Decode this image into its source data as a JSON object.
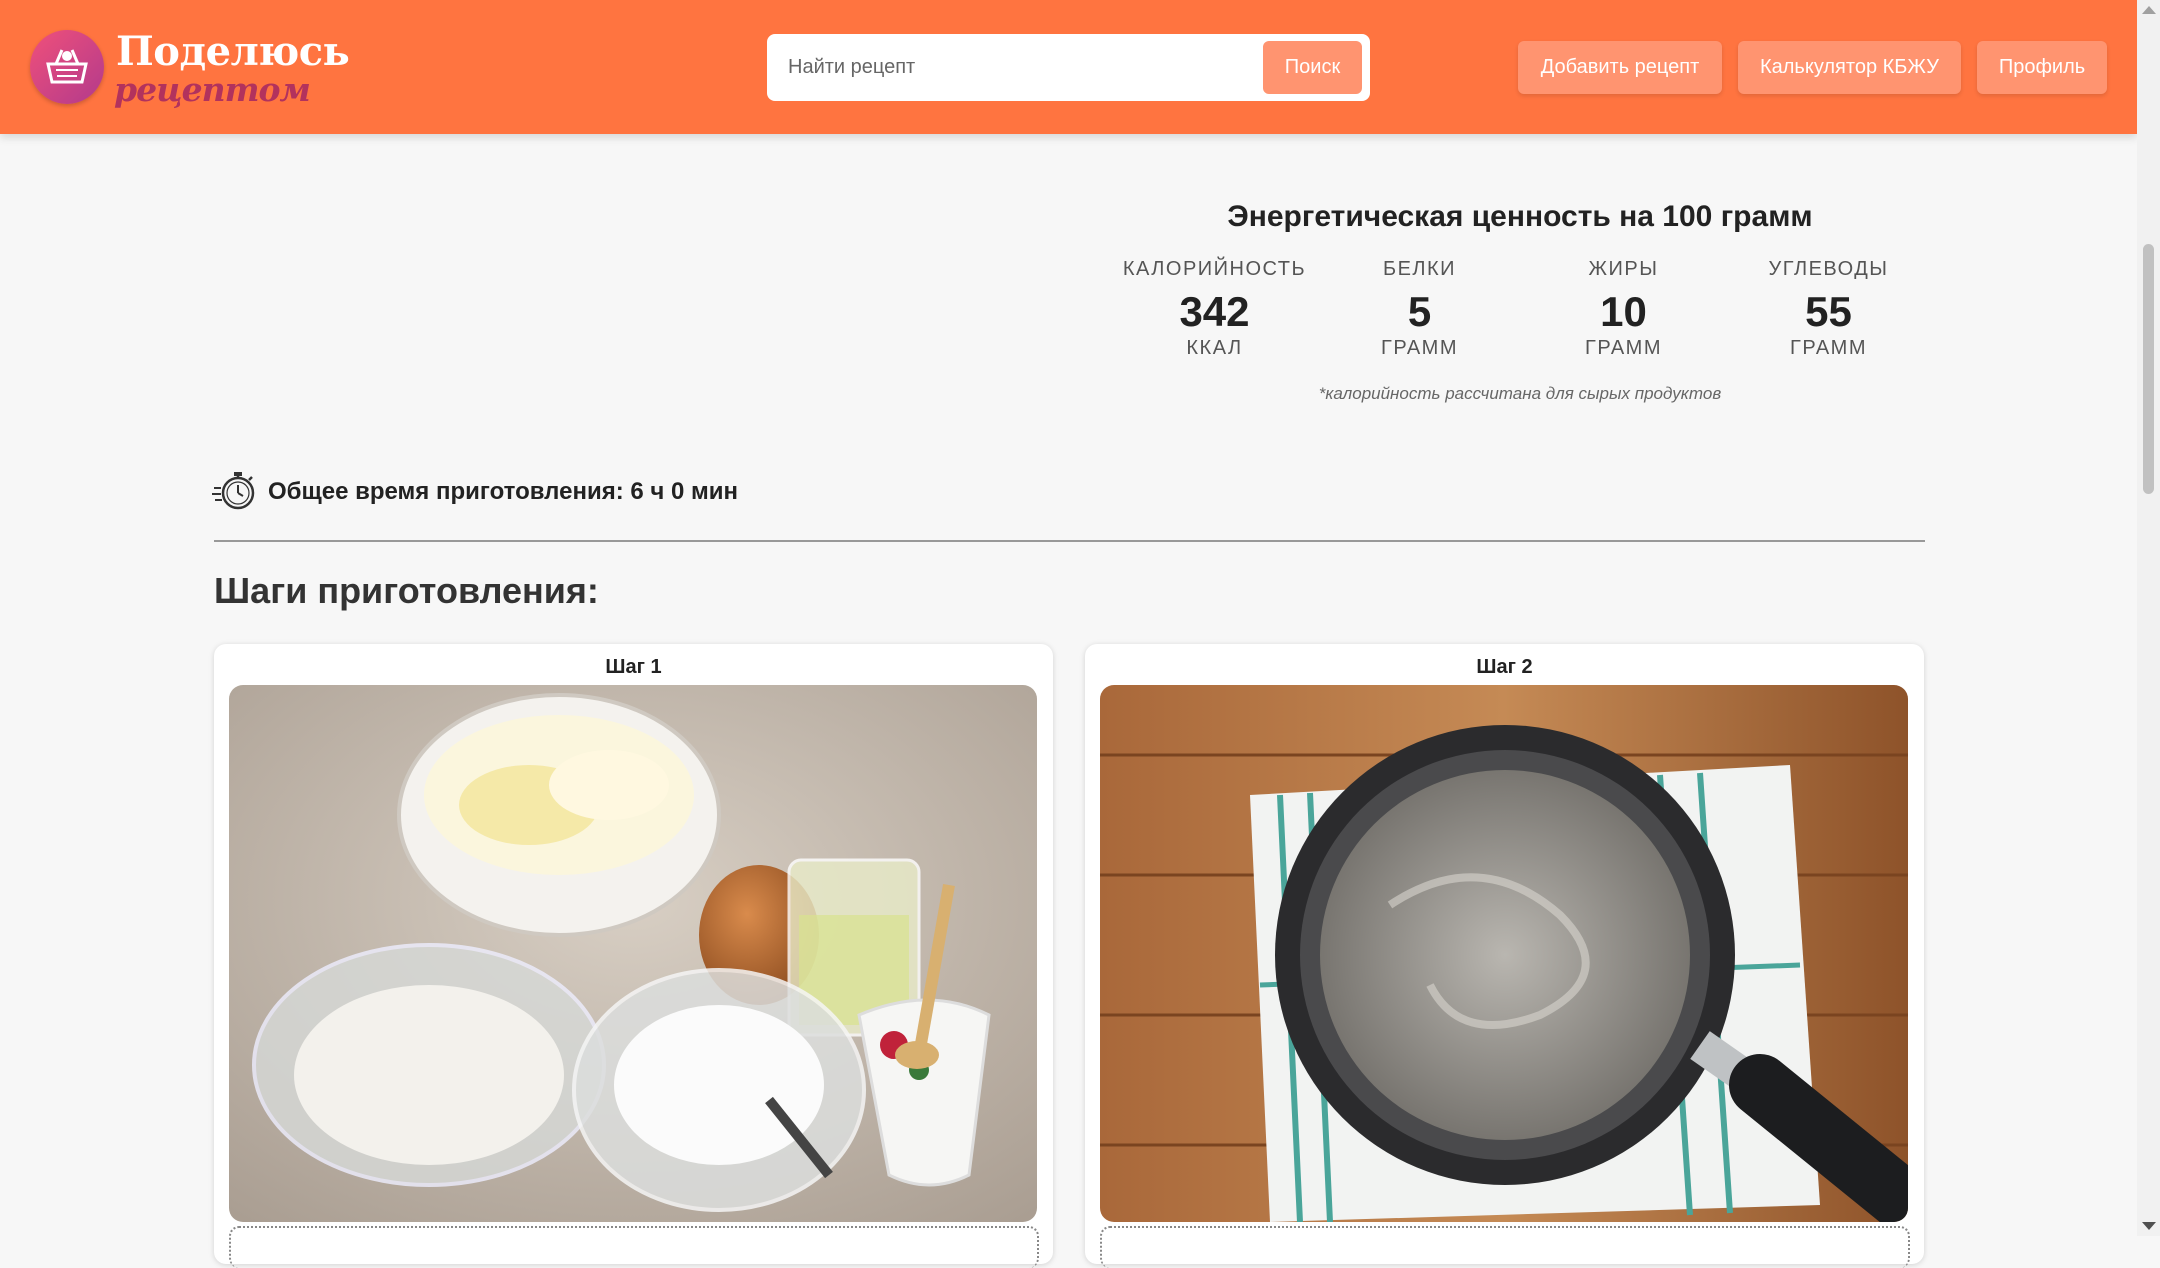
{
  "header": {
    "logo_line1": "Поделюсь",
    "logo_line2": "рецептом",
    "search": {
      "placeholder": "Найти рецепт",
      "button_label": "Поиск"
    },
    "nav": [
      "Добавить рецепт",
      "Калькулятор КБЖУ",
      "Профиль"
    ]
  },
  "energy": {
    "title": "Энергетическая ценность на 100 грамм",
    "items": [
      {
        "label": "КАЛОРИЙНОСТЬ",
        "value": "342",
        "unit": "ККАЛ"
      },
      {
        "label": "БЕЛКИ",
        "value": "5",
        "unit": "ГРАММ"
      },
      {
        "label": "ЖИРЫ",
        "value": "10",
        "unit": "ГРАММ"
      },
      {
        "label": "УГЛЕВОДЫ",
        "value": "55",
        "unit": "ГРАММ"
      }
    ],
    "note": "*калорийность рассчитана для сырых продуктов"
  },
  "total_time": {
    "text": "Общее время приготовления: 6 ч 0 мин",
    "icon": "stopwatch-icon"
  },
  "steps_section": {
    "title": "Шаги приготовления:",
    "steps": [
      {
        "title": "Шаг 1",
        "photo": "ingredients-photo"
      },
      {
        "title": "Шаг 2",
        "photo": "saucepan-photo"
      }
    ]
  },
  "colors": {
    "header_bg": "#ff7440",
    "button_bg": "#ff9470",
    "logo_accent": "#b2325d"
  }
}
